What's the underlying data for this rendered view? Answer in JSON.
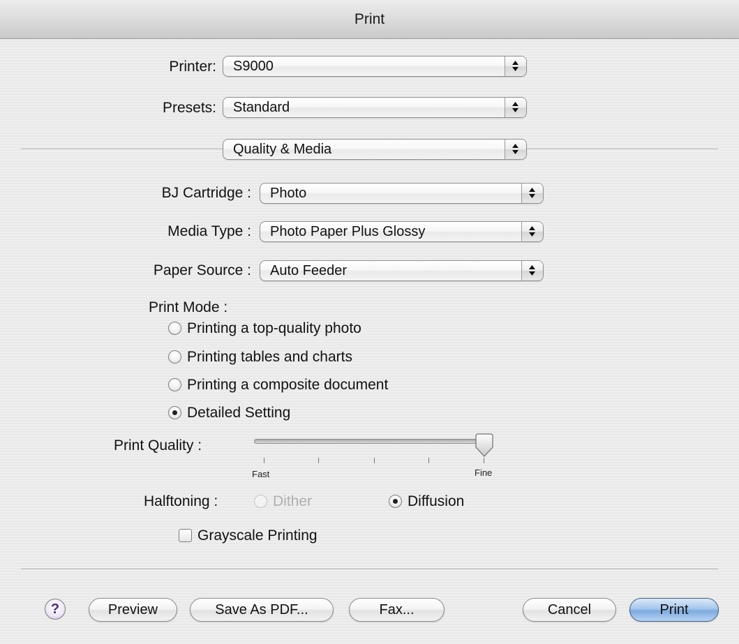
{
  "window": {
    "title": "Print"
  },
  "printer": {
    "label": "Printer:",
    "value": "S9000"
  },
  "presets": {
    "label": "Presets:",
    "value": "Standard"
  },
  "pane": {
    "value": "Quality & Media"
  },
  "cartridge": {
    "label": "BJ Cartridge :",
    "value": "Photo"
  },
  "media_type": {
    "label": "Media Type :",
    "value": "Photo Paper Plus Glossy"
  },
  "paper_source": {
    "label": "Paper Source :",
    "value": "Auto Feeder"
  },
  "print_mode": {
    "label": "Print Mode :",
    "options": [
      {
        "label": "Printing a top-quality photo",
        "selected": false
      },
      {
        "label": "Printing tables and charts",
        "selected": false
      },
      {
        "label": "Printing a composite document",
        "selected": false
      },
      {
        "label": "Detailed Setting",
        "selected": true
      }
    ]
  },
  "print_quality": {
    "label": "Print Quality :",
    "min_label": "Fast",
    "max_label": "Fine",
    "steps": 5,
    "value": 5
  },
  "halftoning": {
    "label": "Halftoning :",
    "options": [
      {
        "label": "Dither",
        "selected": false,
        "enabled": false
      },
      {
        "label": "Diffusion",
        "selected": true,
        "enabled": true
      }
    ]
  },
  "grayscale": {
    "label": "Grayscale Printing",
    "checked": false
  },
  "buttons": {
    "help": "?",
    "preview": "Preview",
    "save_pdf": "Save As PDF...",
    "fax": "Fax...",
    "cancel": "Cancel",
    "print": "Print"
  },
  "colors": {
    "default_button": "#7eaae0",
    "window_bg": "#ececec"
  }
}
